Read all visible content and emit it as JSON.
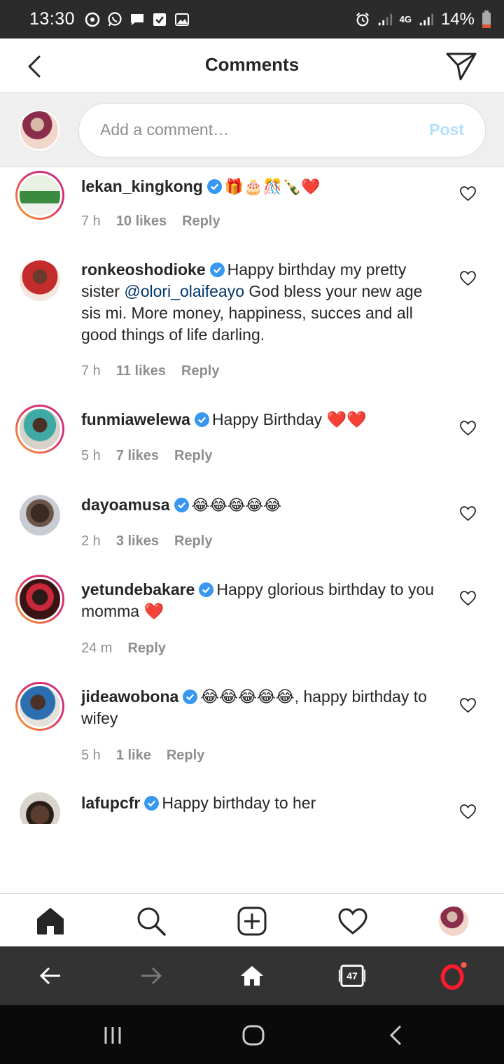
{
  "status_bar": {
    "time": "13:30",
    "network": "4G",
    "battery": "14%"
  },
  "header": {
    "title": "Comments"
  },
  "comment_input": {
    "placeholder": "Add a comment…",
    "post_label": "Post"
  },
  "comments": [
    {
      "username": "lekan_kingkong",
      "text": "🎁🎂🎊🍾❤️",
      "time": "7 h",
      "likes": "10 likes",
      "reply": "Reply"
    },
    {
      "username": "ronkeoshodioke",
      "text_before": "Happy birthday my pretty sister ",
      "mention": "@olori_olaifeayo",
      "text_after": " God bless your new age sis mi. More money, happiness, succes and all good things of life darling.",
      "time": "7 h",
      "likes": "11 likes",
      "reply": "Reply"
    },
    {
      "username": "funmiawelewa",
      "text": "Happy Birthday ❤️❤️",
      "time": "5 h",
      "likes": "7 likes",
      "reply": "Reply"
    },
    {
      "username": "dayoamusa",
      "text": "😂😂😂😂😂",
      "time": "2 h",
      "likes": "3 likes",
      "reply": "Reply"
    },
    {
      "username": "yetundebakare",
      "text": "Happy glorious birthday to you momma ❤️",
      "time": "24 m",
      "reply": "Reply"
    },
    {
      "username": "jideawobona",
      "text": "😂😂😂😂😂, happy birthday to wifey",
      "time": "5 h",
      "likes": "1 like",
      "reply": "Reply"
    },
    {
      "username": "lafupcfr",
      "text": "Happy birthday to her"
    }
  ],
  "browser_bar": {
    "tab_count": "47"
  },
  "colors": {
    "accent_blue": "#3897f0",
    "post_disabled": "#b2dffc",
    "mention": "#00376b",
    "heart_red": "#ed4956"
  }
}
